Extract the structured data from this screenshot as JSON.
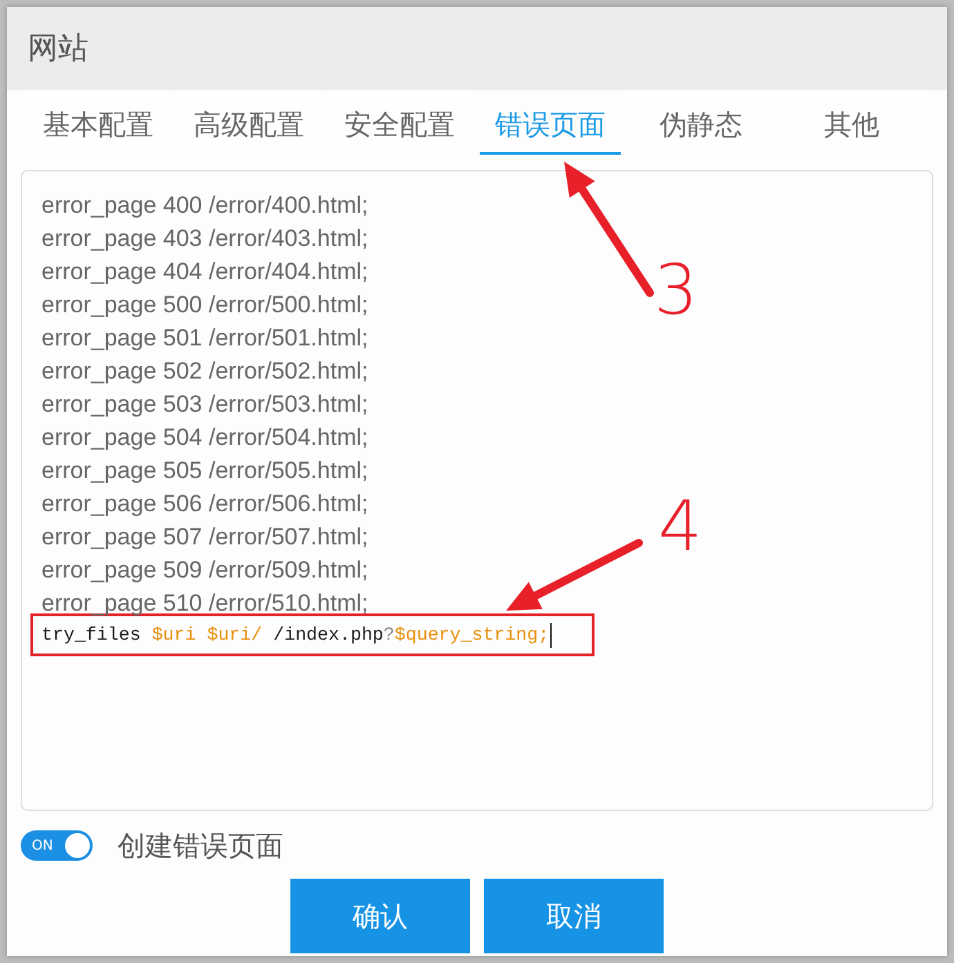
{
  "window": {
    "title": "网站"
  },
  "tabs": [
    {
      "label": "基本配置",
      "selected": false
    },
    {
      "label": "高级配置",
      "selected": false
    },
    {
      "label": "安全配置",
      "selected": false
    },
    {
      "label": "错误页面",
      "selected": true
    },
    {
      "label": "伪静态",
      "selected": false
    },
    {
      "label": "其他",
      "selected": false
    }
  ],
  "editor": {
    "lines": [
      "error_page 400 /error/400.html;",
      "error_page 403 /error/403.html;",
      "error_page 404 /error/404.html;",
      "error_page 500 /error/500.html;",
      "error_page 501 /error/501.html;",
      "error_page 502 /error/502.html;",
      "error_page 503 /error/503.html;",
      "error_page 504 /error/504.html;",
      "error_page 505 /error/505.html;",
      "error_page 506 /error/506.html;",
      "error_page 507 /error/507.html;",
      "error_page 509 /error/509.html;",
      "error_page 510 /error/510.html;"
    ],
    "boxed_line": {
      "boxed": true,
      "caret": true,
      "tokens": [
        {
          "text": "try_files",
          "kind": "plain"
        },
        {
          "text": "$uri",
          "kind": "variable"
        },
        {
          "text": "$uri/",
          "kind": "variable"
        },
        {
          "text": "/index.php",
          "kind": "plain"
        },
        {
          "text": "?",
          "kind": "punct"
        },
        {
          "text": "$query_string;",
          "kind": "variable"
        }
      ]
    }
  },
  "switch": {
    "label": "ON",
    "on": true,
    "caption": "创建错误页面"
  },
  "buttons": [
    {
      "label": "确认"
    },
    {
      "label": "取消"
    }
  ],
  "annotations": [
    {
      "number": "3"
    },
    {
      "number": "4"
    }
  ]
}
